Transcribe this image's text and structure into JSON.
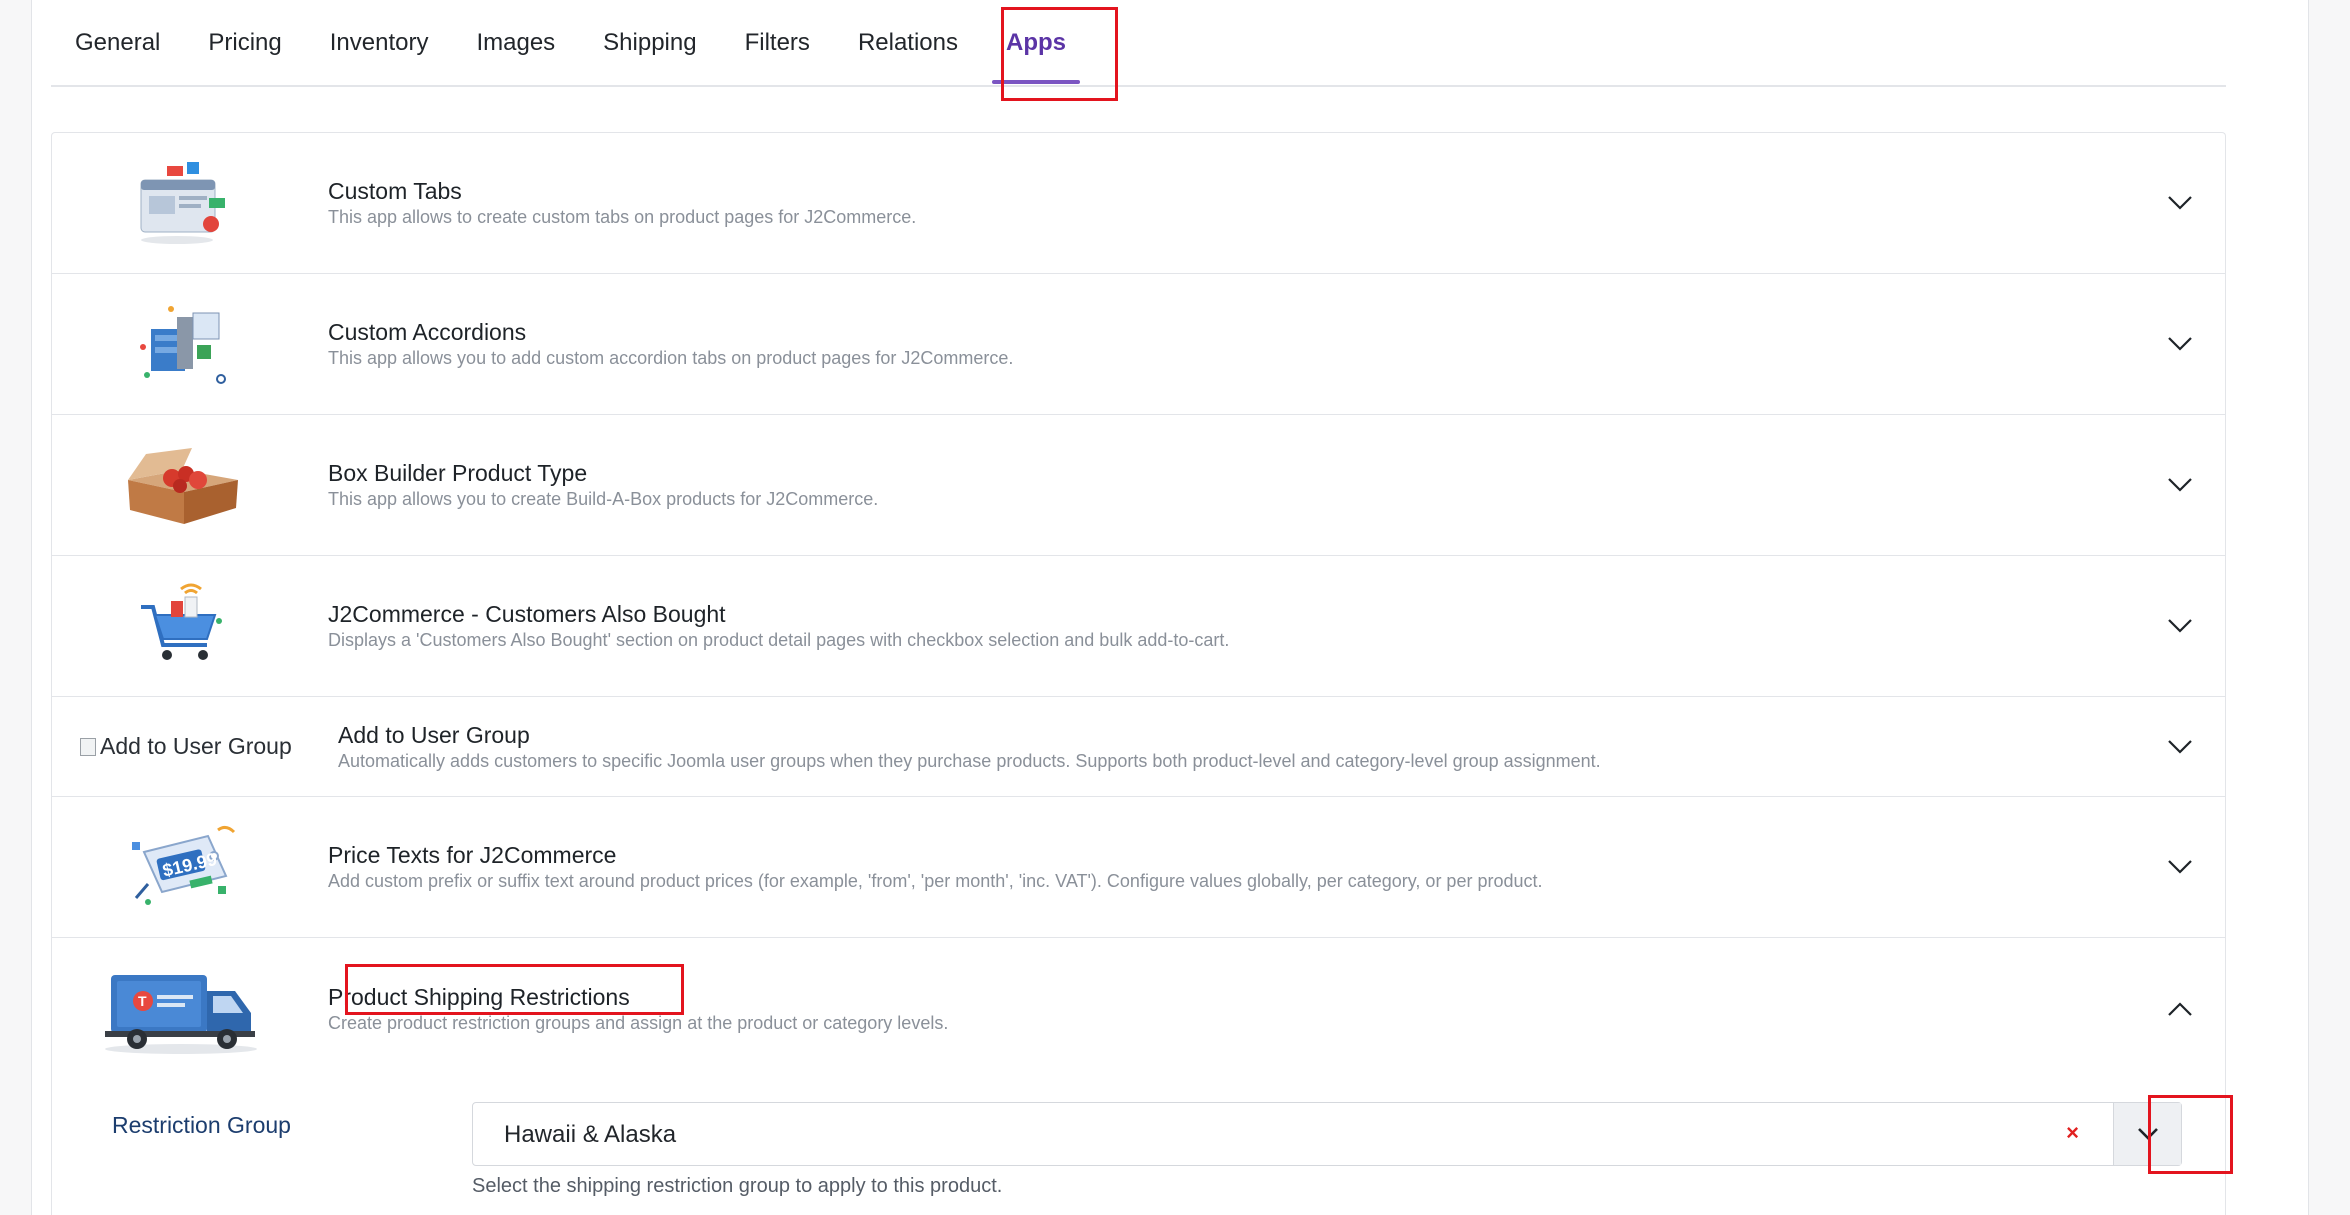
{
  "tabs": [
    {
      "label": "General"
    },
    {
      "label": "Pricing"
    },
    {
      "label": "Inventory"
    },
    {
      "label": "Images"
    },
    {
      "label": "Shipping"
    },
    {
      "label": "Filters"
    },
    {
      "label": "Relations"
    },
    {
      "label": "Apps",
      "active": true
    }
  ],
  "apps": [
    {
      "title": "Custom Tabs",
      "description": "This app allows to create custom tabs on product pages for J2Commerce.",
      "icon": "custom-tabs-icon",
      "expanded": false
    },
    {
      "title": "Custom Accordions",
      "description": "This app allows you to add custom accordion tabs on product pages for J2Commerce.",
      "icon": "custom-accordions-icon",
      "expanded": false
    },
    {
      "title": "Box Builder Product Type",
      "description": "This app allows you to create Build-A-Box products for J2Commerce.",
      "icon": "box-builder-icon",
      "expanded": false
    },
    {
      "title": "J2Commerce - Customers Also Bought",
      "description": "Displays a 'Customers Also Bought' section on product detail pages with checkbox selection and bulk add-to-cart.",
      "icon": "shopping-cart-icon",
      "expanded": false
    },
    {
      "title": "Add to User Group",
      "description": "Automatically adds customers to specific Joomla user groups when they purchase products. Supports both product-level and category-level group assignment.",
      "image_alt": "Add to User Group",
      "expanded": false
    },
    {
      "title": "Price Texts for J2Commerce",
      "description": "Add custom prefix or suffix text around product prices (for example, 'from', 'per month', 'inc. VAT'). Configure values globally, per category, or per product.",
      "icon": "price-tag-icon",
      "expanded": false
    },
    {
      "title": "Product Shipping Restrictions",
      "description": "Create product restriction groups and assign at the product or category levels.",
      "icon": "delivery-truck-icon",
      "expanded": true
    }
  ],
  "restriction": {
    "label": "Restriction Group",
    "value": "Hawaii & Alaska",
    "clear_symbol": "×",
    "help": "Select the shipping restriction group to apply to this product."
  },
  "icons": {
    "chevron_down": "chevron-down-icon",
    "chevron_up": "chevron-up-icon"
  },
  "colors": {
    "accent": "#5b34a6",
    "highlight": "#e3141e"
  }
}
